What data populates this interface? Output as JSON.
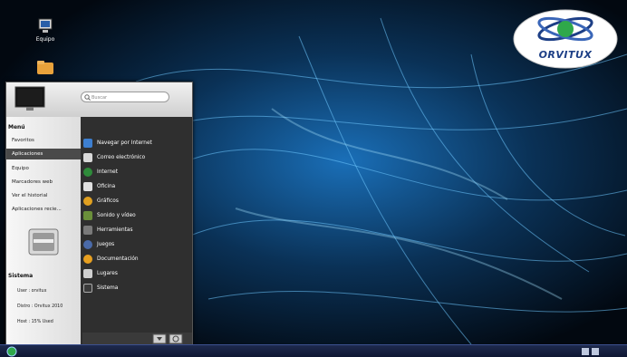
{
  "desktop": {
    "icons": [
      {
        "label": "Equipo",
        "icon": "computer-icon"
      },
      {
        "label": "",
        "icon": "folder-icon"
      }
    ],
    "logo_text": "ORVITUX"
  },
  "menu": {
    "search_placeholder": "Buscar",
    "left": {
      "menu_title": "Menú",
      "categories": [
        {
          "label": "Favoritos",
          "selected": false
        },
        {
          "label": "Aplicaciones",
          "selected": true
        },
        {
          "label": "Equipo",
          "selected": false
        },
        {
          "label": "Marcadores web",
          "selected": false
        },
        {
          "label": "Ver el historial",
          "selected": false
        },
        {
          "label": "Aplicaciones recie...",
          "selected": false
        }
      ],
      "system_title": "Sistema",
      "system_lines": [
        "User : orvitux",
        "Distro : Orvitux 2010",
        "Host : 15% Used"
      ]
    },
    "apps": [
      {
        "label": "Navegar por Internet",
        "icon": "globe-browser-icon",
        "color": "#3d7fd0"
      },
      {
        "label": "Correo electrónico",
        "icon": "mail-icon",
        "color": "#d9d9d9"
      },
      {
        "label": "Internet",
        "icon": "internet-globe-icon",
        "color": "#2e8b3a"
      },
      {
        "label": "Oficina",
        "icon": "office-icon",
        "color": "#e0e0e0"
      },
      {
        "label": "Gráficos",
        "icon": "graphics-icon",
        "color": "#e0a020"
      },
      {
        "label": "Sonido y vídeo",
        "icon": "multimedia-icon",
        "color": "#6a8f3a"
      },
      {
        "label": "Herramientas",
        "icon": "tools-icon",
        "color": "#7a7a7a"
      },
      {
        "label": "Juegos",
        "icon": "games-icon",
        "color": "#4a6aa8"
      },
      {
        "label": "Documentación",
        "icon": "help-icon",
        "color": "#e8a020"
      },
      {
        "label": "Lugares",
        "icon": "places-icon",
        "color": "#d0d0d0"
      },
      {
        "label": "Sistema",
        "icon": "system-icon",
        "color": "#3a3a3a"
      }
    ]
  },
  "colors": {
    "wallpaper": "#04101e",
    "accent": "#1d3f86",
    "taskbar": "#1e2a4e"
  }
}
